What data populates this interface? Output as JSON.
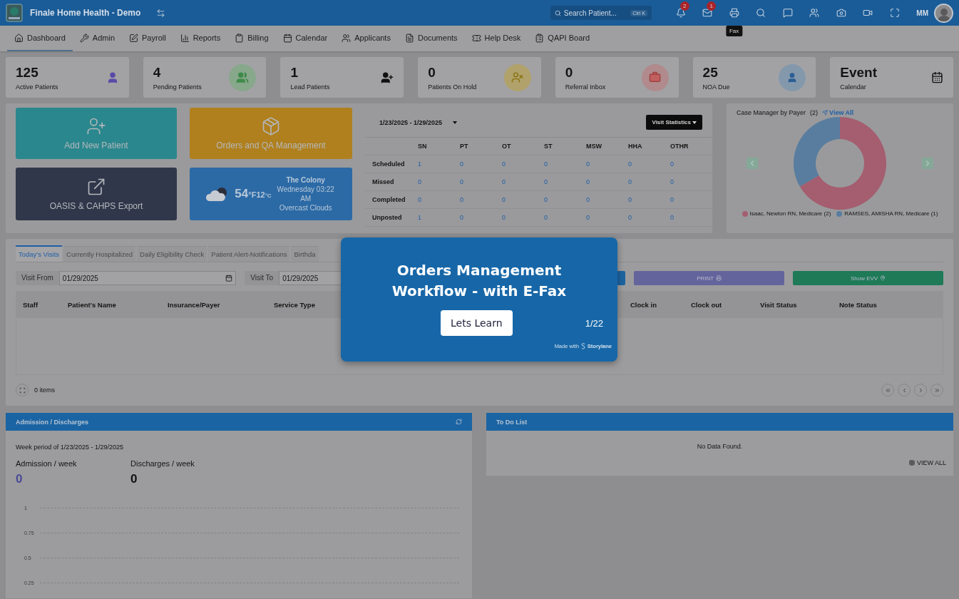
{
  "header": {
    "app_title": "Finale Home Health - Demo",
    "search": {
      "placeholder": "Search Patient...",
      "shortcut": "Ctrl K"
    },
    "toolbar": [
      {
        "kind": "bell",
        "badge": "2"
      },
      {
        "kind": "mail",
        "badge": "1"
      },
      {
        "kind": "printer",
        "tooltip": "Fax"
      },
      {
        "kind": "search"
      },
      {
        "kind": "chat"
      },
      {
        "kind": "users"
      },
      {
        "kind": "camera"
      },
      {
        "kind": "video"
      },
      {
        "kind": "fullscreen"
      }
    ],
    "user_initials": "MM"
  },
  "nav": [
    {
      "label": "Dashboard",
      "kind": "home",
      "selected": true
    },
    {
      "label": "Admin",
      "kind": "wrench",
      "selected": false
    },
    {
      "label": "Payroll",
      "kind": "edit",
      "selected": false
    },
    {
      "label": "Reports",
      "kind": "chart",
      "selected": false
    },
    {
      "label": "Billing",
      "kind": "clipboard",
      "selected": false
    },
    {
      "label": "Calendar",
      "kind": "calendar",
      "selected": false
    },
    {
      "label": "Applicants",
      "kind": "people",
      "selected": false
    },
    {
      "label": "Documents",
      "kind": "document",
      "selected": false
    },
    {
      "label": "Help Desk",
      "kind": "ticket",
      "selected": false
    },
    {
      "label": "QAPI Board",
      "kind": "list",
      "selected": false
    }
  ],
  "stats": [
    {
      "value": "125",
      "label": "Active Patients",
      "kind": "person"
    },
    {
      "value": "4",
      "label": "Pending Patients",
      "kind": "group"
    },
    {
      "value": "1",
      "label": "Lead Patients",
      "kind": "add-user"
    },
    {
      "value": "0",
      "label": "Patients On Hold",
      "kind": "hold"
    },
    {
      "value": "0",
      "label": "Referral Inbox",
      "kind": "briefcase"
    },
    {
      "value": "25",
      "label": "NOA Due",
      "kind": "noa"
    },
    {
      "value": "Event",
      "label": "Calendar",
      "kind": "calendar"
    }
  ],
  "tiles": [
    {
      "label": "Add New Patient",
      "kind": "add-patient"
    },
    {
      "label": "Orders and QA Management",
      "kind": "orders"
    },
    {
      "label": "OASIS & CAHPS Export",
      "kind": "export"
    }
  ],
  "weather": {
    "temp": "54",
    "unit_f": "°F",
    "temp_c": "12",
    "unit_c": "°C",
    "city": "The Colony",
    "time": "Wednesday 03:22 AM",
    "condition": "Overcast Clouds"
  },
  "visit_stats": {
    "date_range": "1/23/2025 - 1/29/2025",
    "menu": "Visit Statistics",
    "columns": [
      "SN",
      "PT",
      "OT",
      "ST",
      "MSW",
      "HHA",
      "OTHR"
    ],
    "rows": [
      {
        "label": "Scheduled",
        "values": [
          "1",
          "0",
          "0",
          "0",
          "0",
          "0",
          "0"
        ]
      },
      {
        "label": "Missed",
        "values": [
          "0",
          "0",
          "0",
          "0",
          "0",
          "0",
          "0"
        ]
      },
      {
        "label": "Completed",
        "values": [
          "0",
          "0",
          "0",
          "0",
          "0",
          "0",
          "0"
        ]
      },
      {
        "label": "Unposted",
        "values": [
          "1",
          "0",
          "0",
          "0",
          "0",
          "0",
          "0"
        ]
      }
    ]
  },
  "case_manager": {
    "title": "Case Manager by Payer",
    "count": "(2)",
    "link": "View All",
    "chart_data": {
      "type": "donut",
      "categories": [
        "Isaac, Newton RN, Medicare (2)",
        "RAMSES, AMISHA RN, Medicare (1)"
      ],
      "values": [
        2,
        1
      ],
      "colors": [
        "#a45e70",
        "#587d9f"
      ]
    }
  },
  "visits": {
    "tabs": [
      {
        "label": "Today's Visits",
        "selected": true
      },
      {
        "label": "Currently Hospitalized",
        "selected": false
      },
      {
        "label": "Daily Eligibility Check",
        "selected": false
      },
      {
        "label": "Patient Alert-Notifications",
        "selected": false
      },
      {
        "label": "Birthda",
        "selected": false
      }
    ],
    "visit_from": {
      "label": "Visit From",
      "value": "01/29/2025"
    },
    "visit_to": {
      "label": "Visit To",
      "value": "01/29/2025"
    },
    "buttons": [
      {
        "kind": "blank"
      },
      {
        "kind": "print",
        "label": "PRINT"
      },
      {
        "kind": "evv",
        "label": "Show EVV"
      }
    ],
    "columns": [
      "Staff",
      "Patient's Name",
      "Insurance/Payer",
      "Service Type",
      "Clock in",
      "Clock out",
      "Visit Status",
      "Note Status"
    ],
    "items": "0 items"
  },
  "admissions": {
    "title": "Admission / Discharges",
    "period": "Week period of 1/23/2025 - 1/29/2025",
    "metrics": [
      {
        "label": "Admission / week",
        "value": "0",
        "kind": "admission"
      },
      {
        "label": "Discharges / week",
        "value": "0",
        "kind": "discharge"
      }
    ],
    "y_ticks": [
      "1",
      "0.75",
      "0.5",
      "0.25"
    ]
  },
  "todo": {
    "title": "To Do List",
    "empty": "No Data Found.",
    "link": "VIEW ALL"
  },
  "popup": {
    "title": "Orders Management Workflow - with E-Fax",
    "button": "Lets Learn",
    "step": "1/22",
    "credit_prefix": "Made with",
    "credit_brand": "Storylane"
  }
}
